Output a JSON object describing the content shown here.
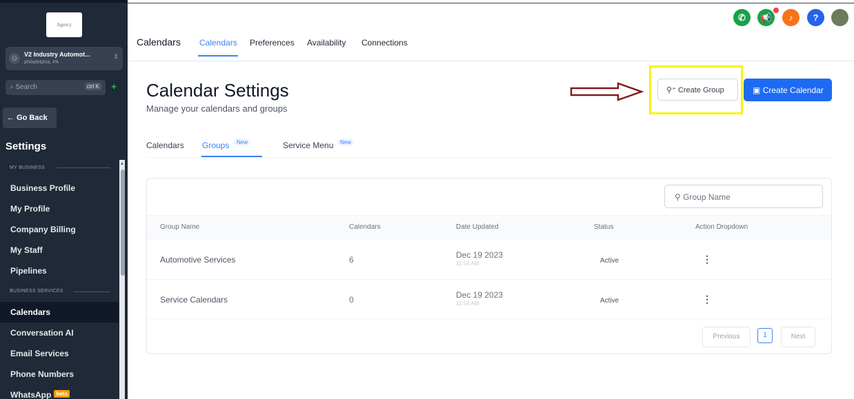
{
  "sidebar": {
    "logo_text": "Agency",
    "account_name": "V2 Industry Automot...",
    "account_location": "philadelphia, PA",
    "search_placeholder": "Search",
    "search_shortcut": "ctrl K",
    "go_back": "← Go Back",
    "settings_title": "Settings",
    "section_my_business": "MY BUSINESS",
    "section_business_services": "BUSINESS SERVICES",
    "items_my_business": [
      "Business Profile",
      "My Profile",
      "Company Billing",
      "My Staff",
      "Pipelines"
    ],
    "items_business_services": [
      "Calendars",
      "Conversation AI",
      "Email Services",
      "Phone Numbers",
      "WhatsApp"
    ],
    "whatsapp_badge": "beta",
    "active_item": "Calendars"
  },
  "header": {
    "title": "Calendars",
    "tabs": [
      "Calendars",
      "Preferences",
      "Availability",
      "Connections"
    ],
    "active_tab": "Calendars",
    "icons": [
      "phone-icon",
      "megaphone-icon",
      "bell-icon",
      "help-icon",
      "avatar"
    ],
    "help_glyph": "?"
  },
  "page": {
    "title": "Calendar Settings",
    "subtitle": "Manage your calendars and groups",
    "create_group": "Create Group",
    "create_calendar": "Create Calendar"
  },
  "inner_tabs": {
    "calendars": "Calendars",
    "groups": "Groups",
    "groups_badge": "New",
    "service_menu": "Service Menu",
    "service_badge": "New"
  },
  "table": {
    "search_placeholder": "Group Name",
    "headers": [
      "Group Name",
      "Calendars",
      "Date Updated",
      "Status",
      "Action Dropdown"
    ],
    "rows": [
      {
        "name": "Automotive Services",
        "calendars": "6",
        "date": "Dec 19 2023",
        "time": "11:54 AM",
        "status": "Active"
      },
      {
        "name": "Service Calendars",
        "calendars": "0",
        "date": "Dec 19 2023",
        "time": "11:54 AM",
        "status": "Active"
      }
    ],
    "pagination": {
      "previous": "Previous",
      "page": "1",
      "next": "Next"
    }
  },
  "colors": {
    "accent": "#3b82f6",
    "primary_button": "#1d6bf3",
    "sidebar_bg": "#1f2937",
    "highlight": "#f5f50a",
    "arrow": "#7f1d1d"
  }
}
